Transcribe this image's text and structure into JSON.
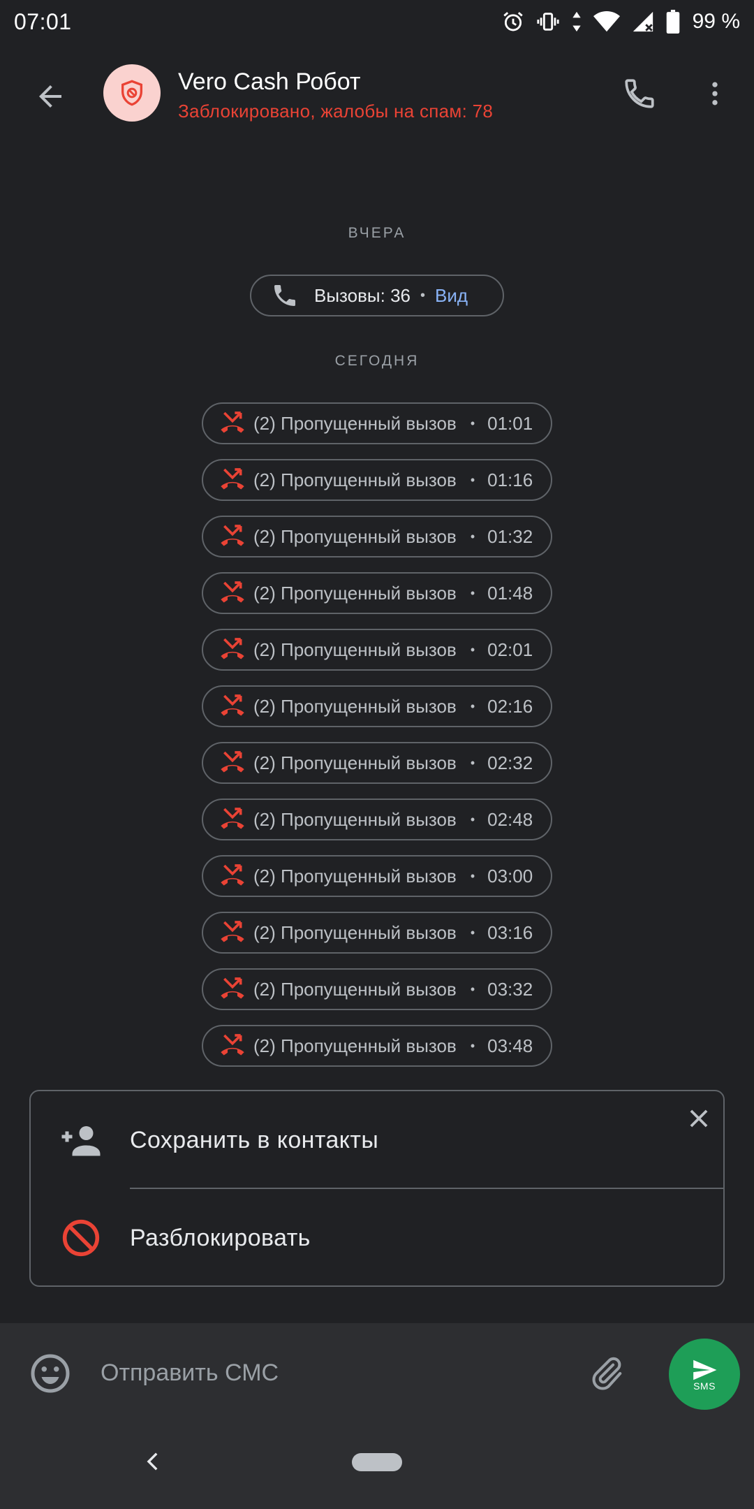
{
  "status_bar": {
    "time": "07:01",
    "battery": "99 %"
  },
  "header": {
    "contact_name": "Vero Cash Робот",
    "subtitle": "Заблокировано, жалобы на спам: 78"
  },
  "thread": {
    "yesterday_label": "ВЧЕРА",
    "summary": {
      "calls_text": "Вызовы: 36",
      "view_link": "Вид"
    },
    "today_label": "СЕГОДНЯ",
    "missed_calls": [
      {
        "label": "(2) Пропущенный вызов",
        "time": "01:01"
      },
      {
        "label": "(2) Пропущенный вызов",
        "time": "01:16"
      },
      {
        "label": "(2) Пропущенный вызов",
        "time": "01:32"
      },
      {
        "label": "(2) Пропущенный вызов",
        "time": "01:48"
      },
      {
        "label": "(2) Пропущенный вызов",
        "time": "02:01"
      },
      {
        "label": "(2) Пропущенный вызов",
        "time": "02:16"
      },
      {
        "label": "(2) Пропущенный вызов",
        "time": "02:32"
      },
      {
        "label": "(2) Пропущенный вызов",
        "time": "02:48"
      },
      {
        "label": "(2) Пропущенный вызов",
        "time": "03:00"
      },
      {
        "label": "(2) Пропущенный вызов",
        "time": "03:16"
      },
      {
        "label": "(2) Пропущенный вызов",
        "time": "03:32"
      },
      {
        "label": "(2) Пропущенный вызов",
        "time": "03:48"
      }
    ]
  },
  "action_card": {
    "save_contact": "Сохранить в контакты",
    "unblock": "Разблокировать"
  },
  "compose": {
    "placeholder": "Отправить СМС",
    "send_label": "SMS"
  },
  "colors": {
    "background": "#202124",
    "danger": "#ea4335",
    "link": "#8ab4f8",
    "send_button": "#1e9e57"
  },
  "icons": {
    "back": "arrow-back-icon",
    "avatar": "blocked-shield-icon",
    "call": "phone-icon",
    "more": "more-vert-icon",
    "missed_call": "missed-call-icon",
    "add_contact": "person-add-icon",
    "unblock": "block-icon",
    "close": "close-icon",
    "emoji": "emoji-icon",
    "attach": "paperclip-icon",
    "send": "send-icon"
  }
}
